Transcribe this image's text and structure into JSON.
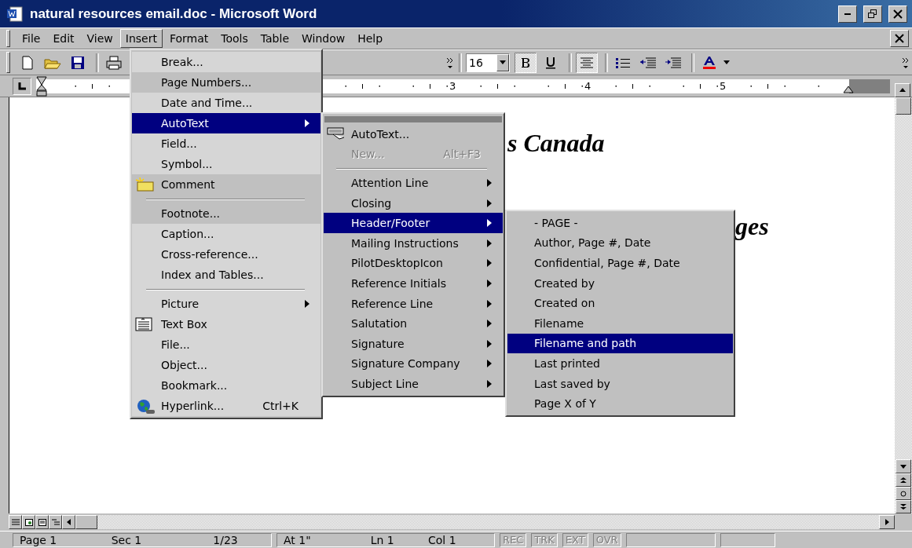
{
  "window": {
    "title": "natural resources email.doc - Microsoft Word"
  },
  "menu_bar": [
    {
      "label": "File",
      "selected": false
    },
    {
      "label": "Edit",
      "selected": false
    },
    {
      "label": "View",
      "selected": false
    },
    {
      "label": "Insert",
      "selected": true
    },
    {
      "label": "Format",
      "selected": false
    },
    {
      "label": "Tools",
      "selected": false
    },
    {
      "label": "Table",
      "selected": false
    },
    {
      "label": "Window",
      "selected": false
    },
    {
      "label": "Help",
      "selected": false
    }
  ],
  "formatting_toolbar": {
    "font_size": "16",
    "bold_on": true,
    "underline_on": false,
    "center_on": true
  },
  "ruler": {
    "marks": [
      "3",
      "4",
      "5"
    ]
  },
  "document": {
    "lines": [
      {
        "text": "s Canada"
      },
      {
        "text": "ges"
      }
    ]
  },
  "insert_menu": {
    "items": [
      {
        "kind": "item",
        "label": "Break...",
        "recessed": true,
        "selected": false,
        "submenu": false
      },
      {
        "kind": "item",
        "label": "Page Numbers...",
        "recessed": false,
        "selected": false,
        "submenu": false
      },
      {
        "kind": "item",
        "label": "Date and Time...",
        "recessed": true,
        "selected": false,
        "submenu": false
      },
      {
        "kind": "item",
        "label": "AutoText",
        "recessed": true,
        "selected": true,
        "submenu": true
      },
      {
        "kind": "item",
        "label": "Field...",
        "recessed": true,
        "selected": false,
        "submenu": false
      },
      {
        "kind": "item",
        "label": "Symbol...",
        "recessed": true,
        "selected": false,
        "submenu": false
      },
      {
        "kind": "item",
        "label": "Comment",
        "recessed": false,
        "selected": false,
        "submenu": false
      },
      {
        "kind": "separator"
      },
      {
        "kind": "item",
        "label": "Footnote...",
        "recessed": false,
        "selected": false,
        "submenu": false
      },
      {
        "kind": "item",
        "label": "Caption...",
        "recessed": true,
        "selected": false,
        "submenu": false
      },
      {
        "kind": "item",
        "label": "Cross-reference...",
        "recessed": true,
        "selected": false,
        "submenu": false
      },
      {
        "kind": "item",
        "label": "Index and Tables...",
        "recessed": true,
        "selected": false,
        "submenu": false
      },
      {
        "kind": "separator"
      },
      {
        "kind": "item",
        "label": "Picture",
        "recessed": true,
        "selected": false,
        "submenu": true
      },
      {
        "kind": "item",
        "label": "Text Box",
        "recessed": true,
        "selected": false,
        "submenu": false
      },
      {
        "kind": "item",
        "label": "File...",
        "recessed": true,
        "selected": false,
        "submenu": false
      },
      {
        "kind": "item",
        "label": "Object...",
        "recessed": true,
        "selected": false,
        "submenu": false
      },
      {
        "kind": "item",
        "label": "Bookmark...",
        "recessed": true,
        "selected": false,
        "submenu": false
      },
      {
        "kind": "item",
        "label": "Hyperlink...",
        "shortcut": "Ctrl+K",
        "recessed": true,
        "selected": false,
        "submenu": false
      }
    ]
  },
  "autotext_menu": {
    "items": [
      {
        "kind": "item",
        "label": "AutoText...",
        "disabled": false,
        "selected": false,
        "submenu": false
      },
      {
        "kind": "item",
        "label": "New...",
        "shortcut": "Alt+F3",
        "disabled": true,
        "selected": false,
        "submenu": false
      },
      {
        "kind": "separator"
      },
      {
        "kind": "item",
        "label": "Attention Line",
        "disabled": false,
        "selected": false,
        "submenu": true
      },
      {
        "kind": "item",
        "label": "Closing",
        "disabled": false,
        "selected": false,
        "submenu": true
      },
      {
        "kind": "item",
        "label": "Header/Footer",
        "disabled": false,
        "selected": true,
        "submenu": true
      },
      {
        "kind": "item",
        "label": "Mailing Instructions",
        "disabled": false,
        "selected": false,
        "submenu": true
      },
      {
        "kind": "item",
        "label": "PilotDesktopIcon",
        "disabled": false,
        "selected": false,
        "submenu": true
      },
      {
        "kind": "item",
        "label": "Reference Initials",
        "disabled": false,
        "selected": false,
        "submenu": true
      },
      {
        "kind": "item",
        "label": "Reference Line",
        "disabled": false,
        "selected": false,
        "submenu": true
      },
      {
        "kind": "item",
        "label": "Salutation",
        "disabled": false,
        "selected": false,
        "submenu": true
      },
      {
        "kind": "item",
        "label": "Signature",
        "disabled": false,
        "selected": false,
        "submenu": true
      },
      {
        "kind": "item",
        "label": "Signature Company",
        "disabled": false,
        "selected": false,
        "submenu": true
      },
      {
        "kind": "item",
        "label": "Subject Line",
        "disabled": false,
        "selected": false,
        "submenu": true
      }
    ]
  },
  "header_footer_menu": {
    "items": [
      {
        "label": "- PAGE -",
        "selected": false
      },
      {
        "label": "Author, Page #, Date",
        "selected": false
      },
      {
        "label": "Confidential, Page #, Date",
        "selected": false
      },
      {
        "label": "Created by",
        "selected": false
      },
      {
        "label": "Created on",
        "selected": false
      },
      {
        "label": "Filename",
        "selected": false
      },
      {
        "label": "Filename and path",
        "selected": true
      },
      {
        "label": "Last printed",
        "selected": false
      },
      {
        "label": "Last saved by",
        "selected": false
      },
      {
        "label": "Page X of Y",
        "selected": false
      }
    ]
  },
  "status_bar": {
    "panes": [
      {
        "fields": [
          "Page 1",
          "Sec 1",
          "1/23"
        ]
      },
      {
        "fields": [
          "At 1\"",
          "Ln 1",
          "Col 1"
        ]
      }
    ],
    "indicators": [
      {
        "label": "REC",
        "on": false
      },
      {
        "label": "TRK",
        "on": false
      },
      {
        "label": "EXT",
        "on": false
      },
      {
        "label": "OVR",
        "on": false
      }
    ]
  }
}
